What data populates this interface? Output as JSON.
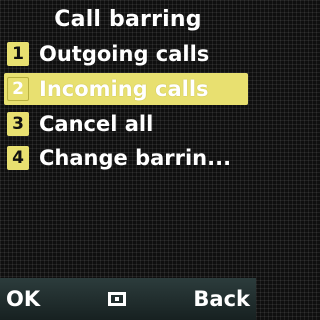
{
  "header": {
    "title": "Call barring"
  },
  "menu": {
    "items": [
      {
        "number": "1",
        "label": "Outgoing calls"
      },
      {
        "number": "2",
        "label": "Incoming calls"
      },
      {
        "number": "3",
        "label": "Cancel all"
      },
      {
        "number": "4",
        "label": "Change barrin..."
      }
    ],
    "selected_index": 1
  },
  "softkeys": {
    "left": "OK",
    "center_icon": "select-square-icon",
    "right": "Back"
  },
  "colors": {
    "highlight": "#e8e070",
    "background": "#0f0f0f",
    "softkey_bar": "#223030"
  }
}
